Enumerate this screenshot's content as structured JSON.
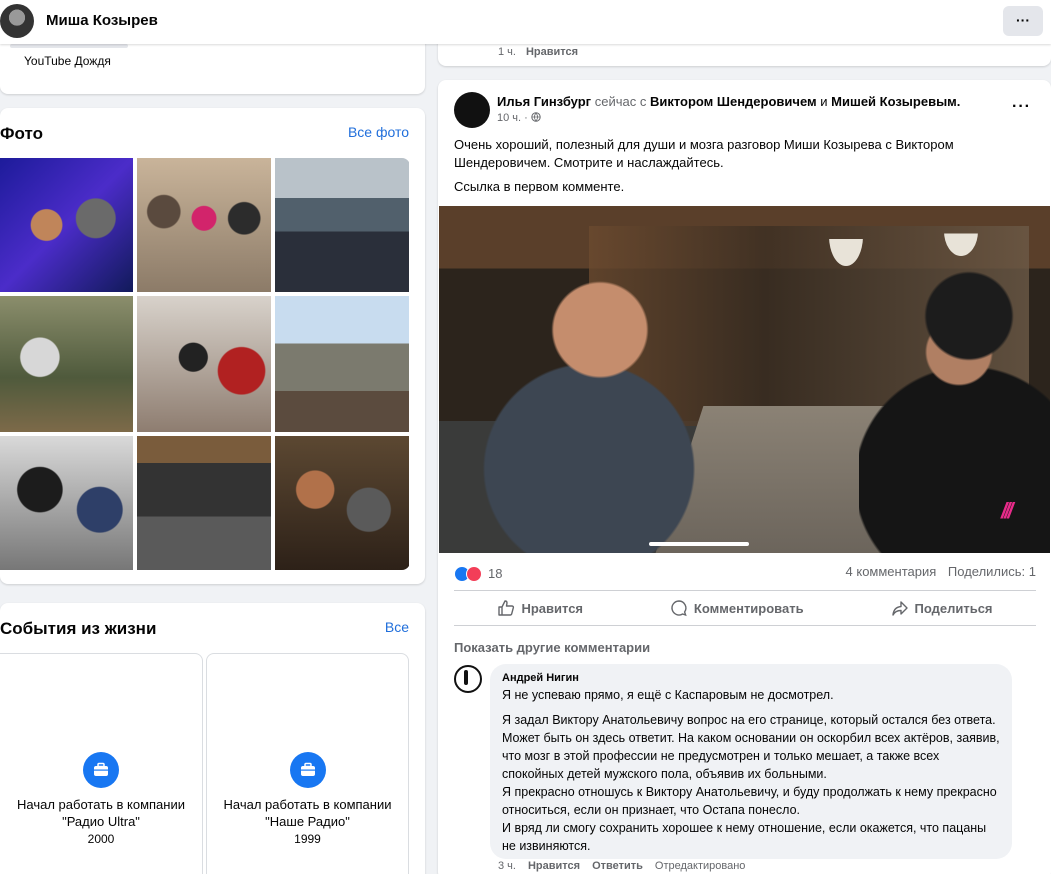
{
  "topbar": {
    "name": "Миша Козырев",
    "more": "···"
  },
  "left": {
    "top_card_label": "YouTube Дождя",
    "photos": {
      "title": "Фото",
      "link": "Все фото"
    },
    "events": {
      "title": "События из жизни",
      "link": "Все",
      "items": [
        {
          "title": "Начал работать в компании \"Радио Ultra\"",
          "year": "2000"
        },
        {
          "title": "Начал работать в компании \"Наше Радио\"",
          "year": "1999"
        }
      ]
    }
  },
  "prev_post": {
    "time": "1 ч.",
    "like": "Нравится"
  },
  "post": {
    "author": "Илья Гинзбург",
    "with_text": "сейчас с",
    "tag1": "Виктором Шендеровичем",
    "and": "и",
    "tag2": "Мишей Козыревым.",
    "time": "10 ч. ·",
    "menu": "···",
    "text": "Очень хороший, полезный для души и мозга разговор Миши Козырева с Виктором Шендеровичем. Смотрите и наслаждайтесь.",
    "text2": "Ссылка в первом комменте.",
    "video_logo": "///",
    "reactions_count": "18",
    "comments_count": "4 комментария",
    "shares_count": "Поделились: 1",
    "actions": {
      "like": "Нравится",
      "comment": "Комментировать",
      "share": "Поделиться"
    },
    "show_more": "Показать другие комментарии",
    "comment": {
      "author": "Андрей Нигин",
      "line1": "Я не успеваю прямо, я ещё с Каспаровым не досмотрел.",
      "para1": "Я задал Виктору Анатольевичу вопрос на его странице, который остался без ответа. Может быть он здесь ответит. На каком основании он оскорбил всех актёров, заявив, что мозг в этой профессии не предусмотрен и только мешает, а также всех спокойных детей мужского пола, объявив их больными.",
      "para2": "Я прекрасно отношусь к Виктору Анатольевичу, и буду продолжать к нему прекрасно относиться, если он признает, что Остапа понесло.",
      "para3": "И вряд ли смогу сохранить хорошее к нему отношение, если окажется, что пацаны не извиняются.",
      "time": "3 ч.",
      "like": "Нравится",
      "reply": "Ответить",
      "edited": "Отредактировано"
    }
  },
  "colors": {
    "accent": "#1877f2",
    "link": "#216fdb",
    "muted": "#65676b",
    "bg": "#f0f2f5"
  }
}
